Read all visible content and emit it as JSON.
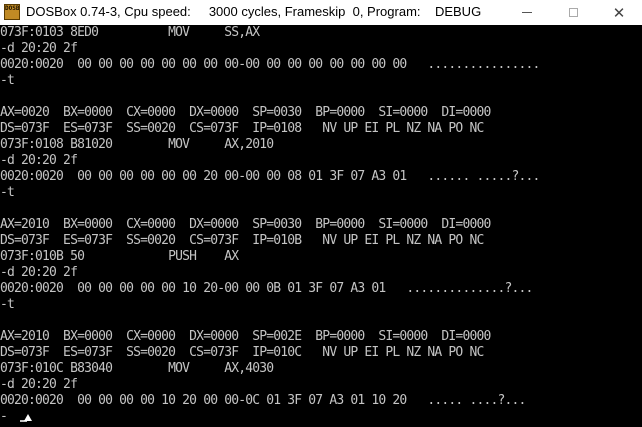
{
  "window": {
    "icon_text": "DOSBOX",
    "title": "DOSBox 0.74-3, Cpu speed:     3000 cycles, Frameskip  0, Program:    DEBUG",
    "minimize_symbol": "",
    "maximize_symbol": "",
    "close_symbol": "✕"
  },
  "console": {
    "lines": [
      "073F:0103 8ED0          MOV     SS,AX",
      "-d 20:20 2f",
      "0020:0020  00 00 00 00 00 00 00 00-00 00 00 00 00 00 00 00   ................",
      "-t",
      "",
      "AX=0020  BX=0000  CX=0000  DX=0000  SP=0030  BP=0000  SI=0000  DI=0000",
      "DS=073F  ES=073F  SS=0020  CS=073F  IP=0108   NV UP EI PL NZ NA PO NC",
      "073F:0108 B81020        MOV     AX,2010",
      "-d 20:20 2f",
      "0020:0020  00 00 00 00 00 00 20 00-00 00 08 01 3F 07 A3 01   ...... .....?...",
      "-t",
      "",
      "AX=2010  BX=0000  CX=0000  DX=0000  SP=0030  BP=0000  SI=0000  DI=0000",
      "DS=073F  ES=073F  SS=0020  CS=073F  IP=010B   NV UP EI PL NZ NA PO NC",
      "073F:010B 50            PUSH    AX",
      "-d 20:20 2f",
      "0020:0020  00 00 00 00 00 10 20-00 00 0B 01 3F 07 A3 01   ..............?...",
      "-t",
      "",
      "AX=2010  BX=0000  CX=0000  DX=0000  SP=002E  BP=0000  SI=0000  DI=0000",
      "DS=073F  ES=073F  SS=0020  CS=073F  IP=010C   NV UP EI PL NZ NA PO NC",
      "073F:010C B83040        MOV     AX,4030",
      "-d 20:20 2f",
      "0020:0020  00 00 00 00 10 20 00 00-0C 01 3F 07 A3 01 10 20   ..... ....?..."
    ],
    "prompt": "-"
  }
}
